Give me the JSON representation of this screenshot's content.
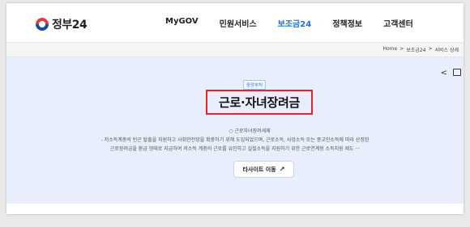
{
  "header": {
    "logo_text": "정부24",
    "nav": [
      "MyGOV",
      "민원서비스",
      "보조금24",
      "정책정보",
      "고객센터"
    ],
    "active_nav": "보조금24"
  },
  "breadcrumb": [
    "Home",
    ">",
    "보조금24",
    ">",
    "서비스 상세"
  ],
  "hero": {
    "badge": "중앙부처",
    "title": "근로·자녀장려금",
    "subtitle": "○ 근로자녀장려세제",
    "desc_line1": "- 저소득계층의 빈곤 탈출을 지원하고 사회안전망을 확충하기 위해 도입되었으며, 근로소득, 사업소득 또는 종교인소득에 따라 산정된",
    "desc_line2": "근로장려금을 환급 형태로 지급하여 저소득 계층의 근로를 유인하고 실질소득을 지원하기 위한 근로연계형 소득지원 제도 ···",
    "button_label": "타사이트 이동",
    "button_icon": "external-arrow-icon"
  },
  "colors": {
    "accent": "#1e6fd9",
    "highlight_border": "#e3242b",
    "hero_bg": "#e8eefb"
  }
}
